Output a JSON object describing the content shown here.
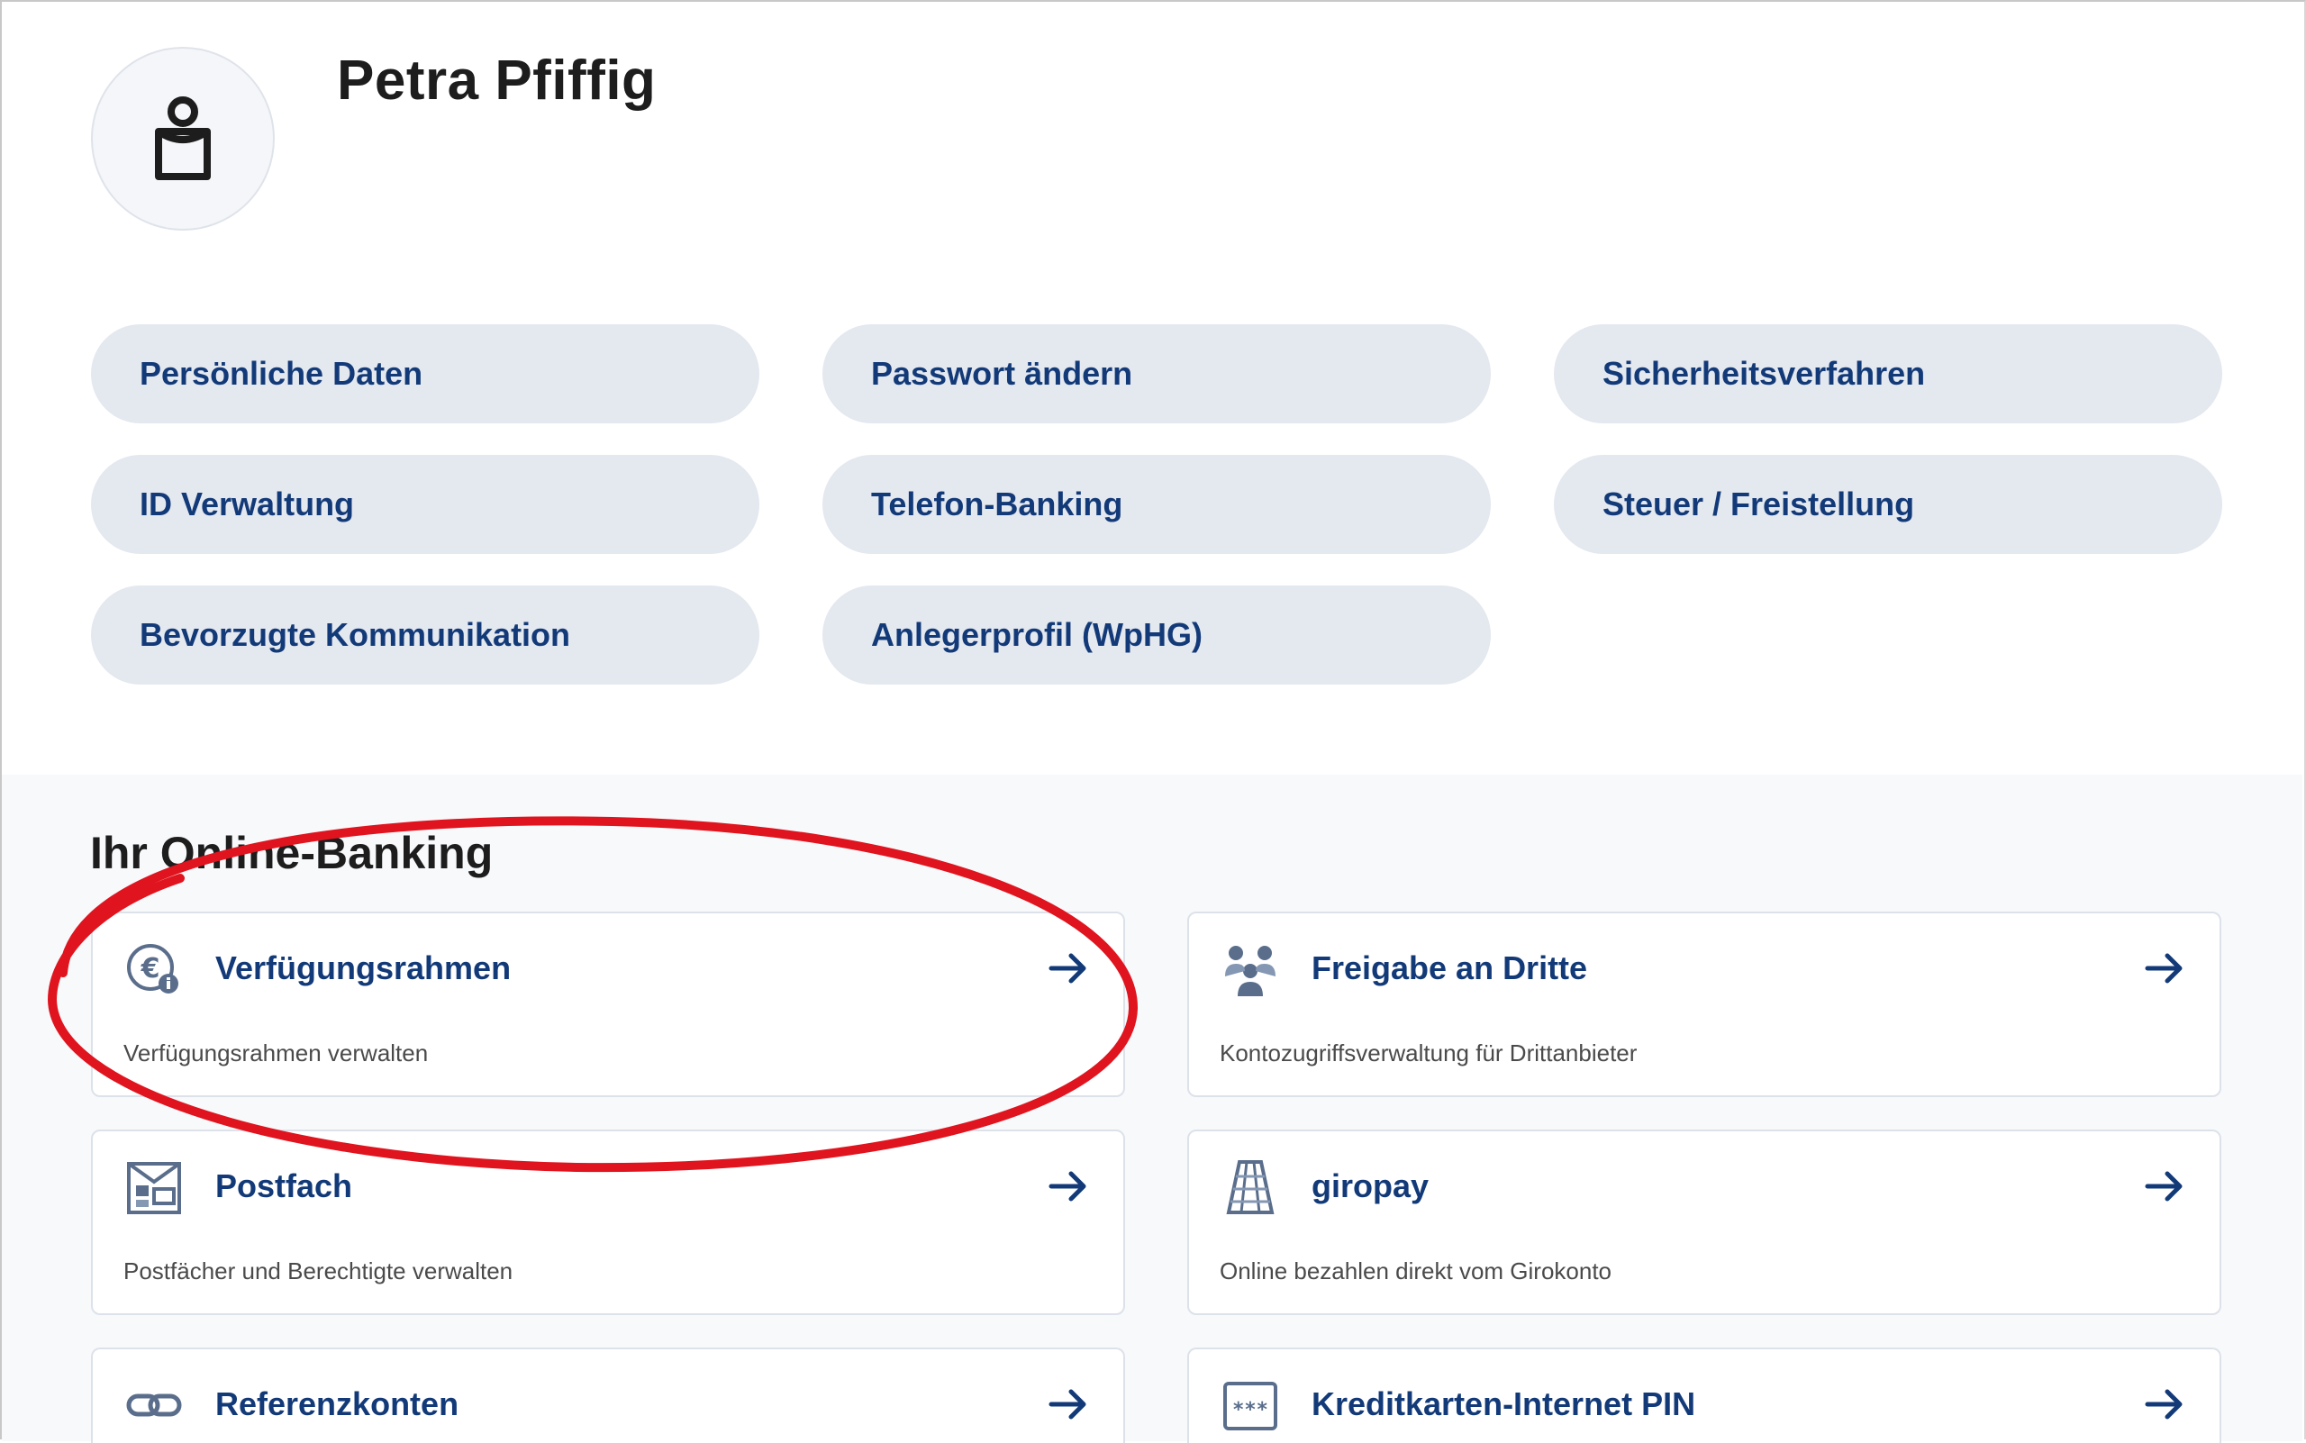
{
  "profile": {
    "name": "Petra Pfiffig",
    "avatar_icon": "user-icon"
  },
  "settings": [
    {
      "label": "Persönliche Daten"
    },
    {
      "label": "Passwort ändern"
    },
    {
      "label": "Sicherheitsverfahren"
    },
    {
      "label": "ID Verwaltung"
    },
    {
      "label": "Telefon-Banking"
    },
    {
      "label": "Steuer / Freistellung"
    },
    {
      "label": "Bevorzugte Kommunikation"
    },
    {
      "label": "Anlegerprofil (WpHG)"
    }
  ],
  "online_banking": {
    "title": "Ihr Online-Banking",
    "cards": [
      {
        "title": "Verfügungsrahmen",
        "description": "Verfügungsrahmen verwalten",
        "icon": "euro-limit-icon"
      },
      {
        "title": "Freigabe an Dritte",
        "description": "Kontozugriffsverwaltung für Drittanbieter",
        "icon": "people-share-icon"
      },
      {
        "title": "Postfach",
        "description": "Postfächer und Berechtigte verwalten",
        "icon": "mailbox-icon"
      },
      {
        "title": "giropay",
        "description": "Online bezahlen direkt vom Girokonto",
        "icon": "giropay-icon"
      },
      {
        "title": "Referenzkonten",
        "description": "",
        "icon": "link-icon"
      },
      {
        "title": "Kreditkarten-Internet PIN",
        "description": "",
        "icon": "pin-card-icon"
      }
    ]
  },
  "colors": {
    "accent_text": "#133a78",
    "pill_bg": "#e4e8ef",
    "annotation_red": "#e0141e"
  }
}
